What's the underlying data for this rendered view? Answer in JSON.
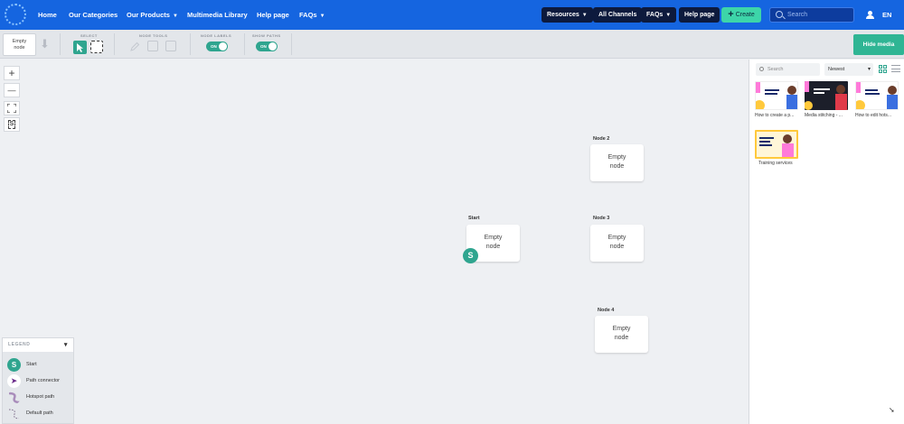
{
  "nav": {
    "links": [
      "Home",
      "Our Categories",
      "Our Products",
      "Multimedia Library",
      "Help page",
      "FAQs"
    ],
    "pills": [
      "Resources",
      "All Channels",
      "FAQs",
      "Help page"
    ],
    "create_label": "Create",
    "search_placeholder": "Search",
    "language": "EN"
  },
  "toolbar": {
    "empty_node_label": "Empty node",
    "groups": {
      "select": "SELECT",
      "node_tools": "NODE TOOLS",
      "node_labels": "NODE LABELS",
      "show_paths": "SHOW PATHS"
    },
    "node_labels_toggle": "ON",
    "show_paths_toggle": "ON",
    "hide_media_label": "Hide media"
  },
  "canvas": {
    "zoom_in": "+",
    "zoom_out": "—",
    "nodes": [
      {
        "label": "Node 2",
        "text": "Empty node"
      },
      {
        "label": "Start",
        "text": "Empty node"
      },
      {
        "label": "Node 3",
        "text": "Empty node"
      },
      {
        "label": "Node 4",
        "text": "Empty node"
      }
    ],
    "start_badge": "S"
  },
  "legend": {
    "title": "LEGEND",
    "items": [
      "Start",
      "Path connector",
      "Hotspot path",
      "Default path"
    ]
  },
  "media": {
    "search_placeholder": "Search",
    "sort": "Newest",
    "items": [
      "How to create a p...",
      "Media stitching - ...",
      "How to edit hots...",
      "Training services"
    ]
  },
  "colors": {
    "nav_bg": "#1565e0",
    "accent": "#2fa58f",
    "pill_bg": "#0d1a3d"
  }
}
